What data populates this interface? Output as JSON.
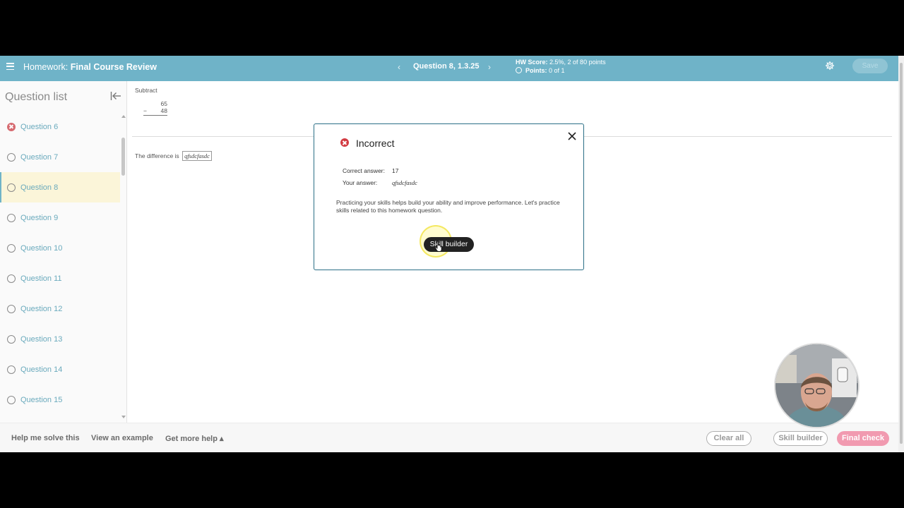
{
  "header": {
    "hw_prefix": "Homework:",
    "hw_title": "Final Course Review",
    "prev_symbol": "‹",
    "question_label": "Question 8, 1.3.25",
    "next_symbol": "›",
    "hw_score_label": "HW Score:",
    "hw_score_value": "2.5%, 2 of 80 points",
    "points_label": "Points:",
    "points_value": "0 of 1",
    "save_label": "Save",
    "icons": [
      "menu-icon",
      "gear-icon"
    ]
  },
  "sidebar": {
    "title": "Question list",
    "items": [
      {
        "label": "Question 6",
        "status": "incorrect"
      },
      {
        "label": "Question 7",
        "status": "unanswered"
      },
      {
        "label": "Question 8",
        "status": "current"
      },
      {
        "label": "Question 9",
        "status": "unanswered"
      },
      {
        "label": "Question 10",
        "status": "unanswered"
      },
      {
        "label": "Question 11",
        "status": "unanswered"
      },
      {
        "label": "Question 12",
        "status": "unanswered"
      },
      {
        "label": "Question 13",
        "status": "unanswered"
      },
      {
        "label": "Question 14",
        "status": "unanswered"
      },
      {
        "label": "Question 15",
        "status": "unanswered"
      }
    ]
  },
  "question": {
    "instruction": "Subtract",
    "top_number": "65",
    "operator": "−",
    "bottom_number": "48",
    "difference_prefix": "The difference is",
    "student_answer": "qfsdcfasdc"
  },
  "modal": {
    "title": "Incorrect",
    "correct_label": "Correct answer:",
    "correct_value": "17",
    "your_label": "Your answer:",
    "your_value": "qfsdcfasdc",
    "message": "Practicing your skills helps build your ability and improve performance. Let's practice skills related to this homework question.",
    "skill_builder_label": "Skill builder"
  },
  "footer": {
    "help_solve": "Help me solve this",
    "view_example": "View an example",
    "get_more_help": "Get more help ▴",
    "clear_all": "Clear all",
    "skill_builder": "Skill builder",
    "final_check": "Final check"
  },
  "colors": {
    "header_bg": "#6fb3c8",
    "link": "#6aaabd",
    "incorrect": "#d23b42",
    "final_check": "#f19ab0",
    "current_bg": "#fbf5d9"
  }
}
